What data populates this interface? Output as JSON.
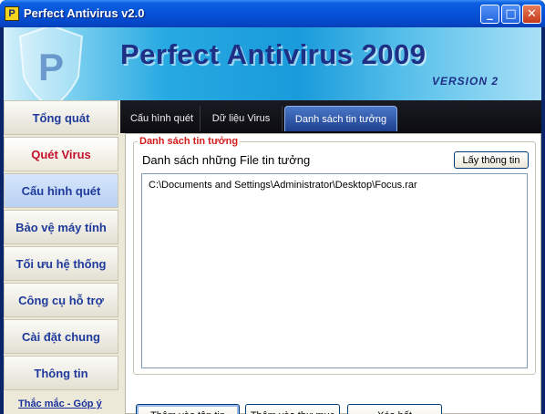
{
  "window": {
    "title": "Perfect Antivirus v2.0",
    "controls": {
      "minimize": "_",
      "maximize": "□",
      "close": "✕"
    }
  },
  "banner": {
    "title": "Perfect Antivirus 2009",
    "version": "VERSION 2",
    "logo_letter": "P"
  },
  "nav": {
    "items": [
      {
        "label": "Tổng quát"
      },
      {
        "label": "Quét Virus"
      },
      {
        "label": "Cấu hình quét"
      },
      {
        "label": "Bảo vệ máy tính"
      },
      {
        "label": "Tối ưu hệ thống"
      },
      {
        "label": "Công cụ hỗ trợ"
      },
      {
        "label": "Cài đặt chung"
      },
      {
        "label": "Thông tin"
      }
    ],
    "footer_link": "Thắc mắc - Góp ý"
  },
  "tabs": [
    {
      "label": "Cấu hình quét"
    },
    {
      "label": "Dữ liệu Virus"
    },
    {
      "label": "Danh sách tin tưởng"
    }
  ],
  "panel": {
    "group_legend": "Danh sách tin tưởng",
    "group_title": "Danh sách những File tin tưởng",
    "fetch_button": "Lấy thông tin",
    "list_items": [
      "C:\\Documents and Settings\\Administrator\\Desktop\\Focus.rar"
    ],
    "buttons": {
      "add_file": "Thêm vào tập tin",
      "add_folder": "Thêm vào thư mục",
      "clear_all": "Xóa hết"
    }
  },
  "colors": {
    "accent_red": "#d21c1c",
    "nav_text": "#1f3a9c",
    "titlebar_blue": "#0652d8"
  }
}
